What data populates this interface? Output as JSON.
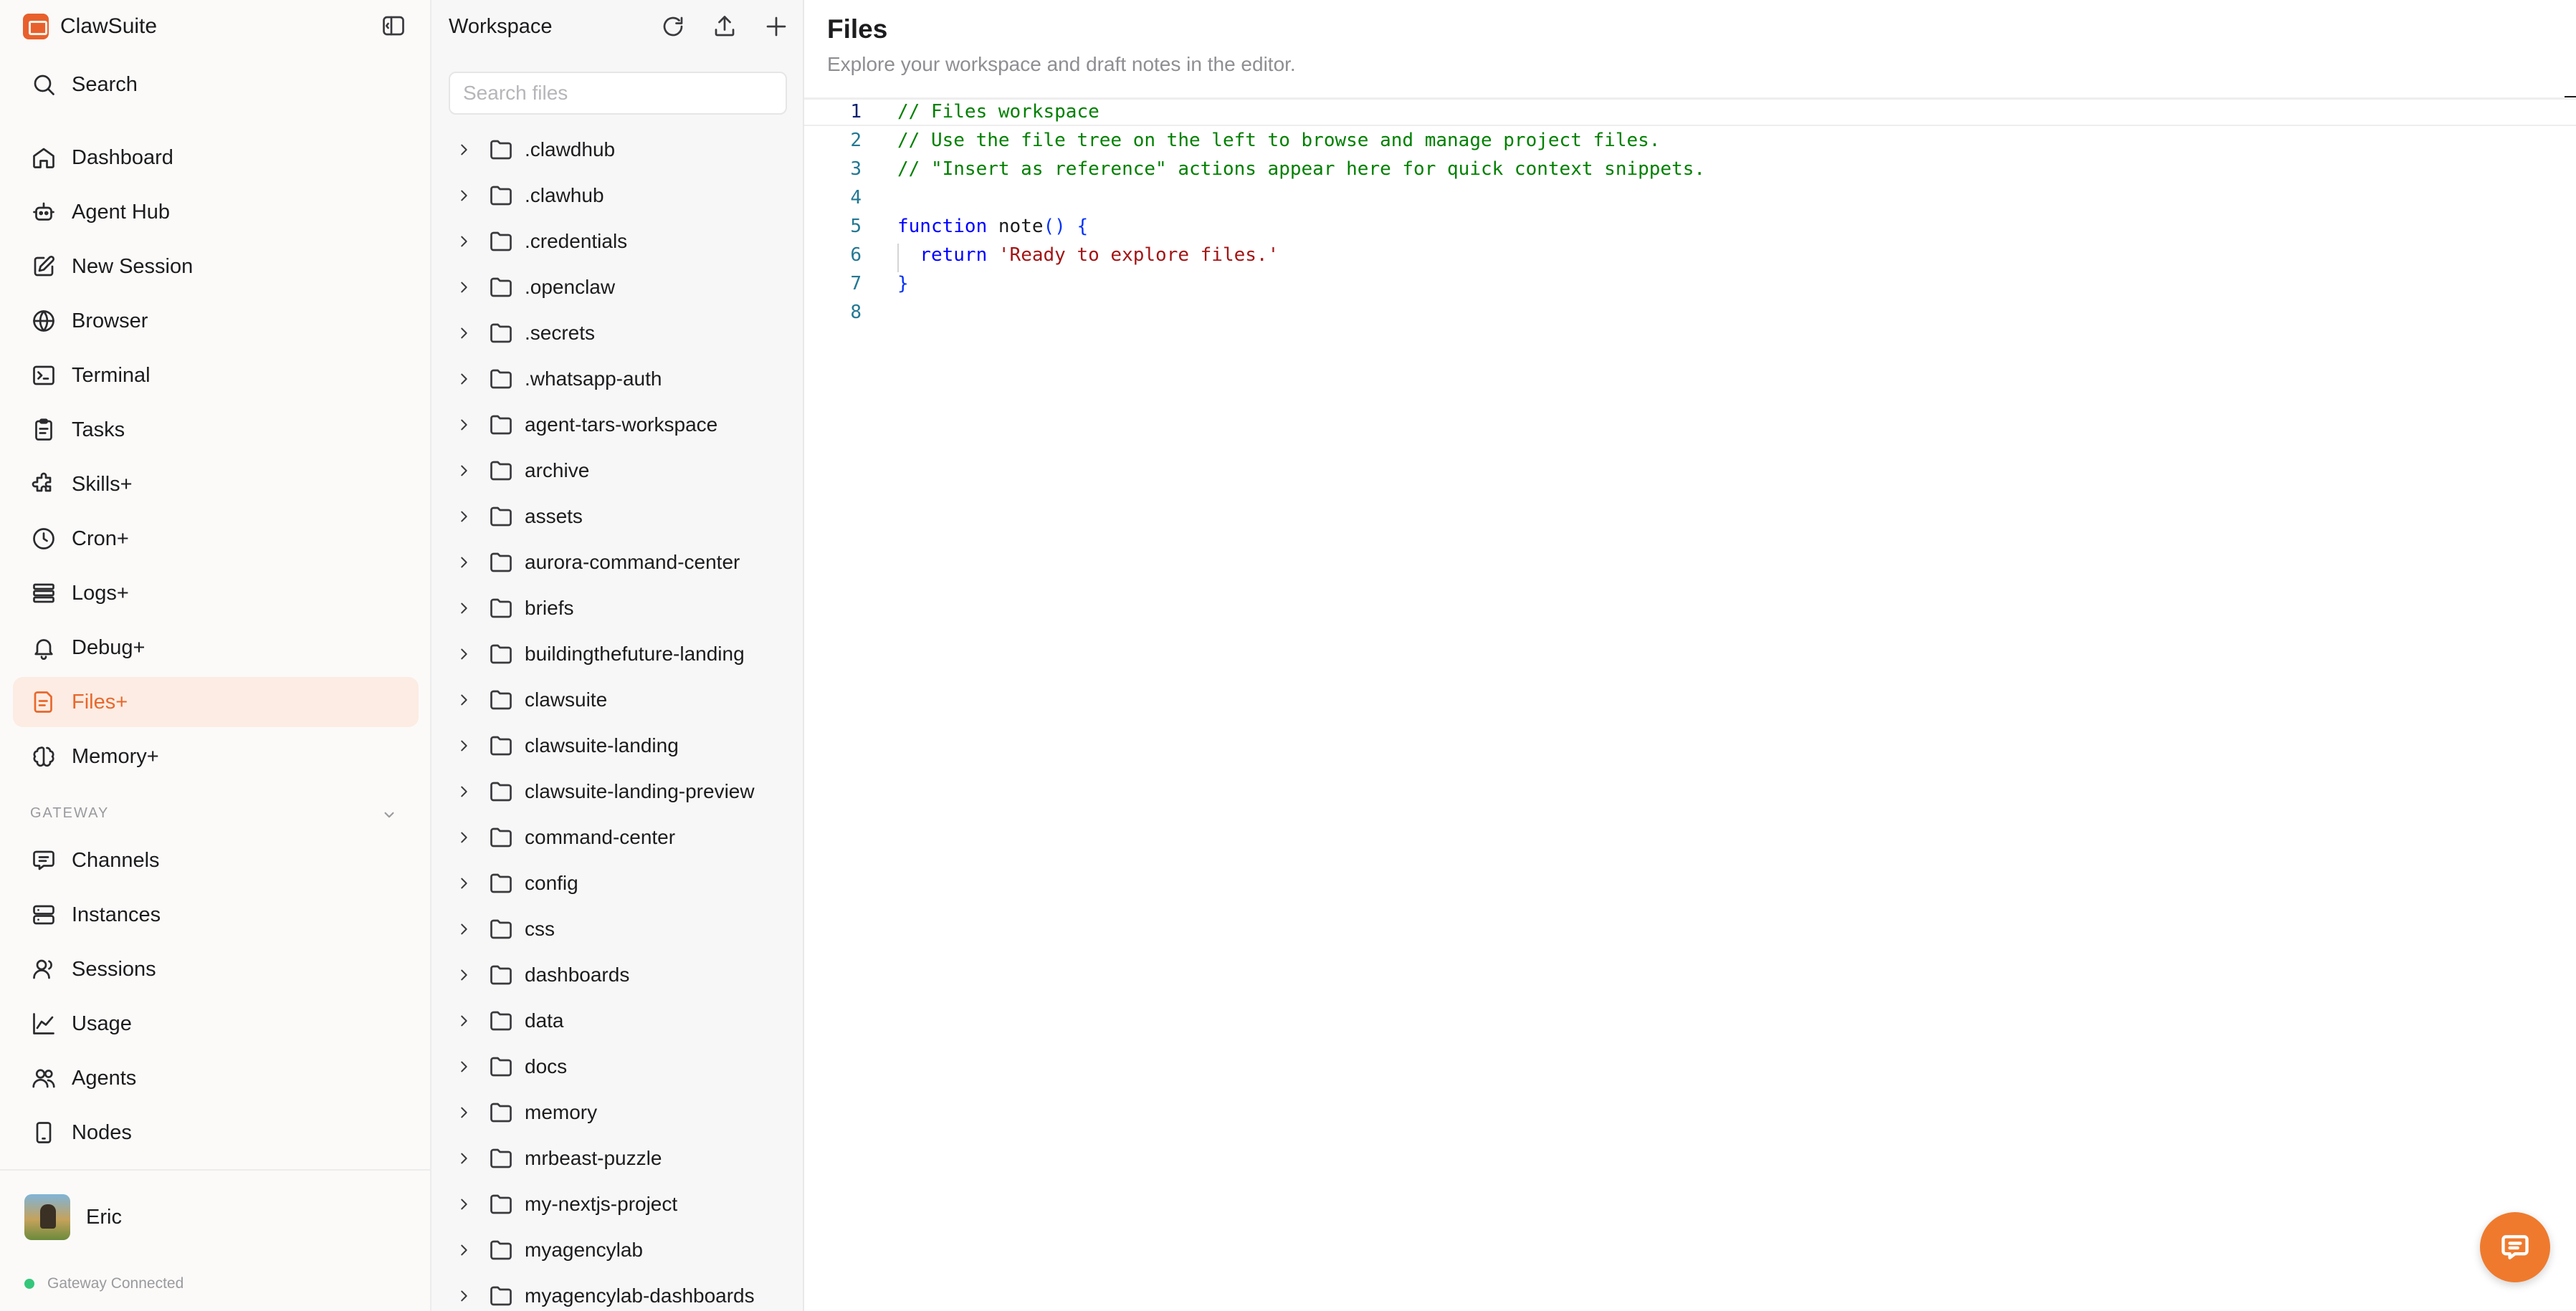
{
  "app": {
    "name": "ClawSuite"
  },
  "sidebar": {
    "items": [
      {
        "label": "Search",
        "icon": "search-icon"
      },
      {
        "label": "Dashboard",
        "icon": "home-icon"
      },
      {
        "label": "Agent Hub",
        "icon": "bot-icon"
      },
      {
        "label": "New Session",
        "icon": "edit-icon"
      },
      {
        "label": "Browser",
        "icon": "globe-icon"
      },
      {
        "label": "Terminal",
        "icon": "terminal-icon"
      },
      {
        "label": "Tasks",
        "icon": "clipboard-icon"
      },
      {
        "label": "Skills+",
        "icon": "puzzle-icon"
      },
      {
        "label": "Cron+",
        "icon": "clock-icon"
      },
      {
        "label": "Logs+",
        "icon": "list-icon"
      },
      {
        "label": "Debug+",
        "icon": "bell-icon"
      },
      {
        "label": "Files+",
        "icon": "file-icon",
        "active": true
      },
      {
        "label": "Memory+",
        "icon": "brain-icon"
      }
    ],
    "gateway_label": "GATEWAY",
    "gateway_items": [
      {
        "label": "Channels",
        "icon": "message-icon"
      },
      {
        "label": "Instances",
        "icon": "server-icon"
      },
      {
        "label": "Sessions",
        "icon": "user-icon"
      },
      {
        "label": "Usage",
        "icon": "chart-line-icon"
      },
      {
        "label": "Agents",
        "icon": "users-icon"
      },
      {
        "label": "Nodes",
        "icon": "device-icon"
      }
    ],
    "user": {
      "name": "Eric"
    },
    "gateway_status": "Gateway Connected",
    "accent_color": "#e8682c",
    "status_color": "#34c77b"
  },
  "file_tree": {
    "title": "Workspace",
    "search_placeholder": "Search files",
    "folders": [
      ".clawdhub",
      ".clawhub",
      ".credentials",
      ".openclaw",
      ".secrets",
      ".whatsapp-auth",
      "agent-tars-workspace",
      "archive",
      "assets",
      "aurora-command-center",
      "briefs",
      "buildingthefuture-landing",
      "clawsuite",
      "clawsuite-landing",
      "clawsuite-landing-preview",
      "command-center",
      "config",
      "css",
      "dashboards",
      "data",
      "docs",
      "memory",
      "mrbeast-puzzle",
      "my-nextjs-project",
      "myagencylab",
      "myagencylab-dashboards"
    ]
  },
  "main": {
    "title": "Files",
    "subtitle": "Explore your workspace and draft notes in the editor.",
    "editor": {
      "current_line": 1,
      "lines": [
        {
          "n": "1",
          "tokens": [
            {
              "t": "// Files workspace",
              "c": "c-comment"
            }
          ]
        },
        {
          "n": "2",
          "tokens": [
            {
              "t": "// Use the file tree on the left to browse and manage project files.",
              "c": "c-comment"
            }
          ]
        },
        {
          "n": "3",
          "tokens": [
            {
              "t": "// \"Insert as reference\" actions appear here for quick context snippets.",
              "c": "c-comment"
            }
          ]
        },
        {
          "n": "4",
          "tokens": []
        },
        {
          "n": "5",
          "tokens": [
            {
              "t": "function",
              "c": "c-kw"
            },
            {
              "t": " note",
              "c": "c-fn"
            },
            {
              "t": "()",
              "c": "c-br"
            },
            {
              "t": " ",
              "c": "c-fn"
            },
            {
              "t": "{",
              "c": "c-br"
            }
          ]
        },
        {
          "n": "6",
          "tokens": [
            {
              "t": "  return",
              "c": "c-kw"
            },
            {
              "t": " ",
              "c": "c-fn"
            },
            {
              "t": "'Ready to explore files.'",
              "c": "c-str"
            }
          ]
        },
        {
          "n": "7",
          "tokens": [
            {
              "t": "}",
              "c": "c-br"
            }
          ]
        },
        {
          "n": "8",
          "tokens": []
        }
      ]
    }
  }
}
